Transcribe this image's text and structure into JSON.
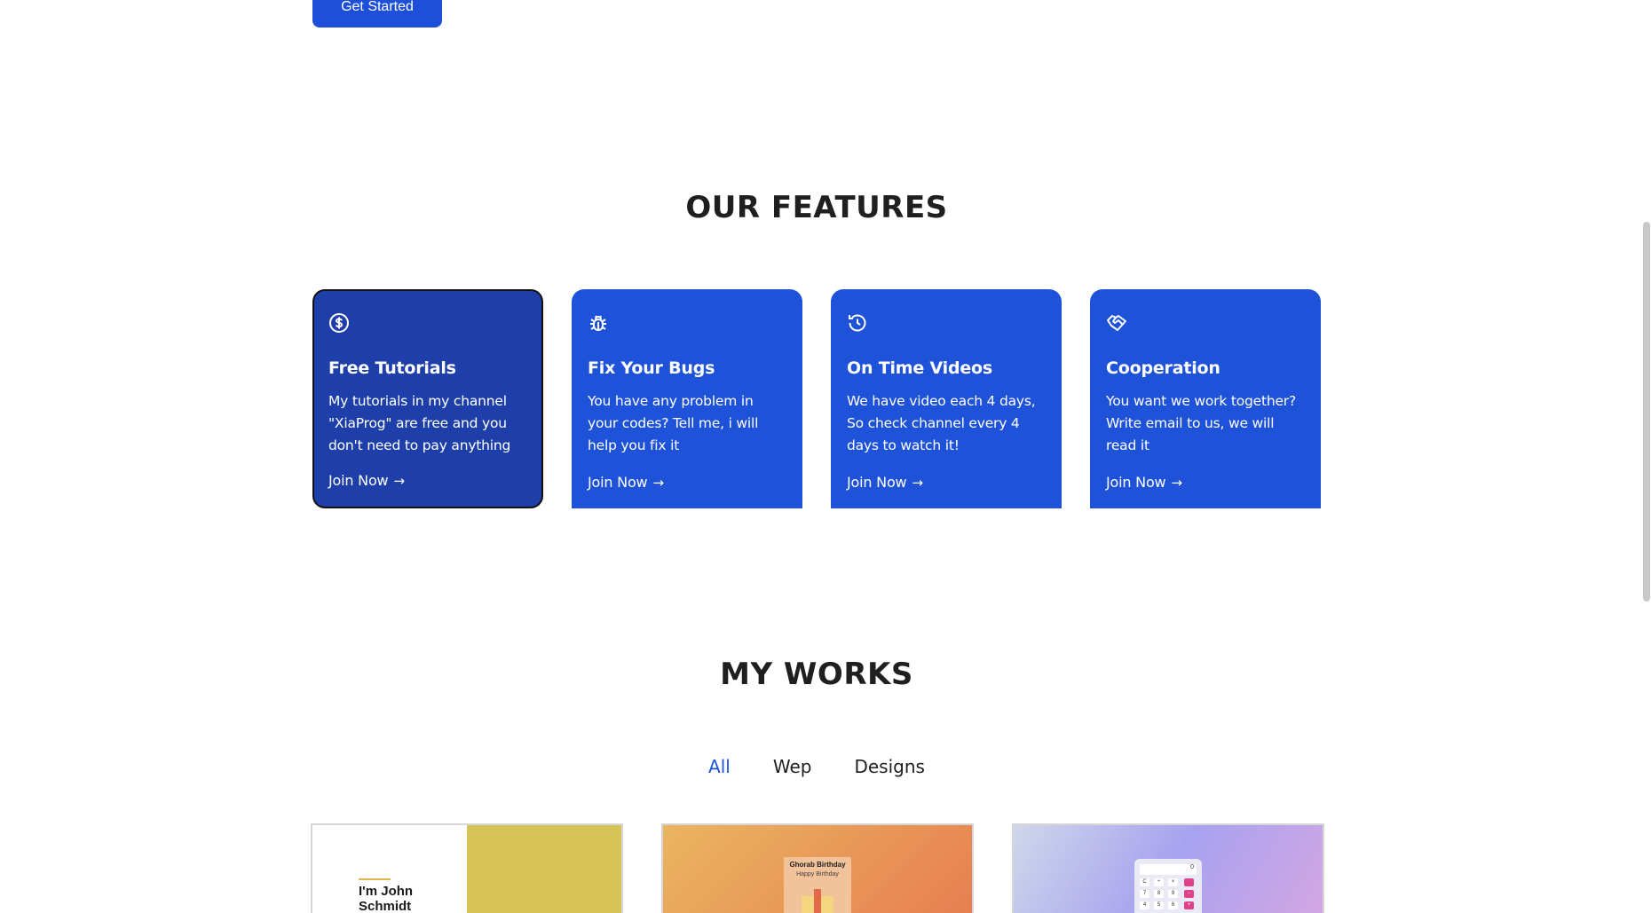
{
  "hero": {
    "cta_label": "Get Started"
  },
  "features": {
    "title": "OUR FEATURES",
    "cards": [
      {
        "icon": "dollar-circle-icon",
        "title": "Free Tutorials",
        "text": "My tutorials in my channel \"XiaProg\" are free and you don't need to pay anything",
        "link": "Join Now"
      },
      {
        "icon": "bug-icon",
        "title": "Fix Your Bugs",
        "text": "You have any problem in your codes? Tell me, i will help you fix it",
        "link": "Join Now"
      },
      {
        "icon": "history-icon",
        "title": "On Time Videos",
        "text": "We have video each 4 days, So check channel every 4 days to watch it!",
        "link": "Join Now"
      },
      {
        "icon": "handshake-icon",
        "title": "Cooperation",
        "text": "You want we work together? Write email to us, we will read it",
        "link": "Join Now"
      }
    ]
  },
  "works": {
    "title": "MY WORKS",
    "filters": [
      "All",
      "Wep",
      "Designs"
    ],
    "active_filter": "All",
    "items": [
      {
        "name_line1": "I'm John",
        "name_line2": "Schmidt"
      },
      {
        "title": "Ghorab Birthday",
        "subtitle": "Happy Birthday"
      },
      {
        "display": "0",
        "keys": [
          "C",
          "÷",
          "×",
          "7",
          "8",
          "9",
          "-",
          "4",
          "5",
          "6",
          "+"
        ]
      }
    ]
  },
  "colors": {
    "primary": "#1e52d9",
    "primary_dark": "#1e3faa",
    "text": "#1f1f1f"
  }
}
